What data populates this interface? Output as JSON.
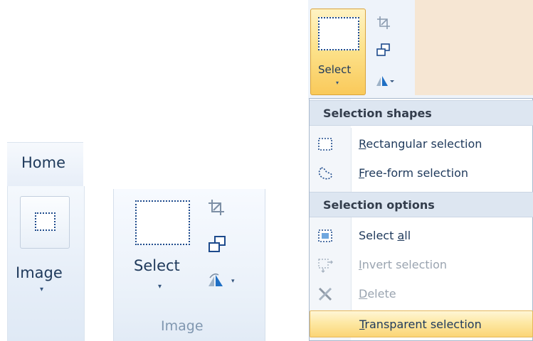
{
  "panel_collapsed": {
    "tab_label": "Home",
    "button_label": "Image",
    "button_icon": "selection-rectangle-icon",
    "dropdown_arrow": "▾"
  },
  "panel_expanded": {
    "select_label": "Select",
    "select_arrow": "▾",
    "group_name": "Image",
    "tools": [
      "crop-icon",
      "resize-icon",
      "rotate-icon"
    ],
    "rotate_arrow": "▾"
  },
  "panel_menu": {
    "select_label": "Select",
    "select_arrow": "▾",
    "sections": [
      {
        "header": "Selection shapes",
        "items": [
          {
            "access": "R",
            "rest": "ectangular selection",
            "icon": "rectangular-selection-icon",
            "enabled": true
          },
          {
            "access": "F",
            "rest": "ree-form selection",
            "icon": "free-form-selection-icon",
            "enabled": true
          }
        ]
      },
      {
        "header": "Selection options",
        "items": [
          {
            "pre": "Select ",
            "access": "a",
            "rest": "ll",
            "icon": "select-all-icon",
            "enabled": true
          },
          {
            "access": "I",
            "rest": "nvert selection",
            "icon": "invert-selection-icon",
            "enabled": false
          },
          {
            "access": "D",
            "rest": "elete",
            "icon": "delete-icon",
            "enabled": false
          },
          {
            "access": "T",
            "rest": "ransparent selection",
            "icon": "",
            "enabled": true,
            "highlighted": true
          }
        ]
      }
    ],
    "colors": {
      "highlight": "#fde8a4",
      "select_button": "#fde38d",
      "canvas": "#f6e6d3",
      "disabled_text": "#9aa4b0"
    }
  }
}
